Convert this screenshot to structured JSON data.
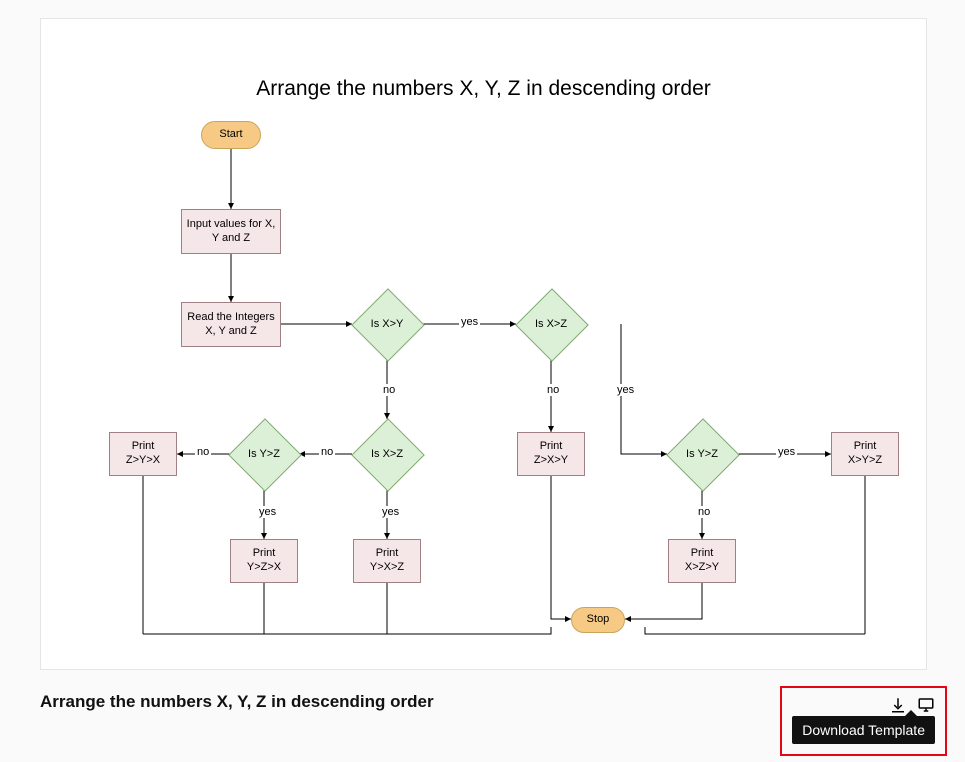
{
  "title": "Arrange the numbers X, Y, Z in descending order",
  "caption": "Arrange the numbers X, Y, Z in descending order",
  "tooltip": {
    "download_template": "Download Template"
  },
  "nodes": {
    "start": "Start",
    "input": "Input values for X, Y and Z",
    "read": "Read the Integers X, Y and Z",
    "d_xy": "Is X>Y",
    "d_xz1": "Is X>Z",
    "d_yz1": "Is Y>Z",
    "d_xz2": "Is X>Z",
    "d_yz2": "Is Y>Z",
    "p_zyx": "Print\nZ>Y>X",
    "p_yzx": "Print\nY>Z>X",
    "p_yxz": "Print\nY>X>Z",
    "p_zxy": "Print\nZ>X>Y",
    "p_xzy": "Print\nX>Z>Y",
    "p_xyz": "Print\nX>Y>Z",
    "stop": "Stop"
  },
  "labels": {
    "yes": "yes",
    "no": "no"
  },
  "chart_data": {
    "type": "flowchart",
    "title": "Arrange the numbers X, Y, Z in descending order",
    "nodes": [
      {
        "id": "start",
        "kind": "terminator",
        "label": "Start"
      },
      {
        "id": "input",
        "kind": "process",
        "label": "Input values for X, Y and Z"
      },
      {
        "id": "read",
        "kind": "process",
        "label": "Read the Integers X, Y and Z"
      },
      {
        "id": "d_xy",
        "kind": "decision",
        "label": "Is X>Y"
      },
      {
        "id": "d_xz1",
        "kind": "decision",
        "label": "Is X>Z"
      },
      {
        "id": "d_yz1",
        "kind": "decision",
        "label": "Is Y>Z"
      },
      {
        "id": "d_xz2",
        "kind": "decision",
        "label": "Is X>Z"
      },
      {
        "id": "d_yz2",
        "kind": "decision",
        "label": "Is Y>Z"
      },
      {
        "id": "p_zyx",
        "kind": "process",
        "label": "Print Z>Y>X"
      },
      {
        "id": "p_yzx",
        "kind": "process",
        "label": "Print Y>Z>X"
      },
      {
        "id": "p_yxz",
        "kind": "process",
        "label": "Print Y>X>Z"
      },
      {
        "id": "p_zxy",
        "kind": "process",
        "label": "Print Z>X>Y"
      },
      {
        "id": "p_xzy",
        "kind": "process",
        "label": "Print X>Z>Y"
      },
      {
        "id": "p_xyz",
        "kind": "process",
        "label": "Print X>Y>Z"
      },
      {
        "id": "stop",
        "kind": "terminator",
        "label": "Stop"
      }
    ],
    "edges": [
      {
        "from": "start",
        "to": "input"
      },
      {
        "from": "input",
        "to": "read"
      },
      {
        "from": "read",
        "to": "d_xy"
      },
      {
        "from": "d_xy",
        "to": "d_xz1",
        "label": "yes"
      },
      {
        "from": "d_xy",
        "to": "d_xz2",
        "label": "no"
      },
      {
        "from": "d_xz1",
        "to": "d_yz1",
        "label": "yes"
      },
      {
        "from": "d_xz1",
        "to": "p_zxy",
        "label": "no"
      },
      {
        "from": "d_yz1",
        "to": "p_xyz",
        "label": "yes"
      },
      {
        "from": "d_yz1",
        "to": "p_xzy",
        "label": "no"
      },
      {
        "from": "d_xz2",
        "to": "p_yxz",
        "label": "yes"
      },
      {
        "from": "d_xz2",
        "to": "d_yz2",
        "label": "no"
      },
      {
        "from": "d_yz2",
        "to": "p_yzx",
        "label": "yes"
      },
      {
        "from": "d_yz2",
        "to": "p_zyx",
        "label": "no"
      },
      {
        "from": "p_zyx",
        "to": "stop"
      },
      {
        "from": "p_yzx",
        "to": "stop"
      },
      {
        "from": "p_yxz",
        "to": "stop"
      },
      {
        "from": "p_zxy",
        "to": "stop"
      },
      {
        "from": "p_xzy",
        "to": "stop"
      },
      {
        "from": "p_xyz",
        "to": "stop"
      }
    ]
  }
}
